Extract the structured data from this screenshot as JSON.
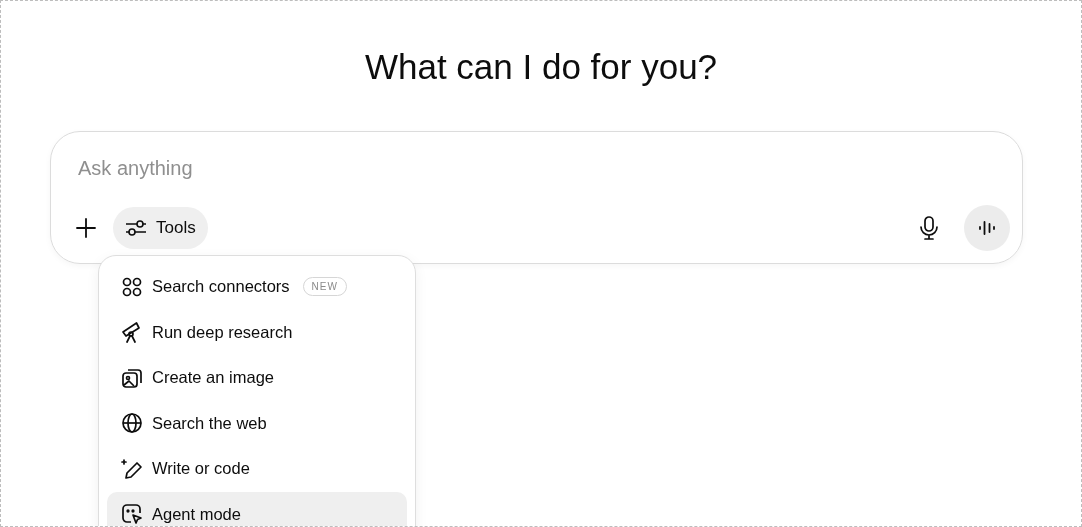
{
  "heading": "What can I do for you?",
  "composer": {
    "placeholder": "Ask anything",
    "tools_label": "Tools"
  },
  "tools_menu": {
    "items": [
      {
        "label": "Search connectors",
        "badge": "NEW",
        "selected": false
      },
      {
        "label": "Run deep research",
        "selected": false
      },
      {
        "label": "Create an image",
        "selected": false
      },
      {
        "label": "Search the web",
        "selected": false
      },
      {
        "label": "Write or code",
        "selected": false
      },
      {
        "label": "Agent mode",
        "selected": true
      }
    ]
  }
}
